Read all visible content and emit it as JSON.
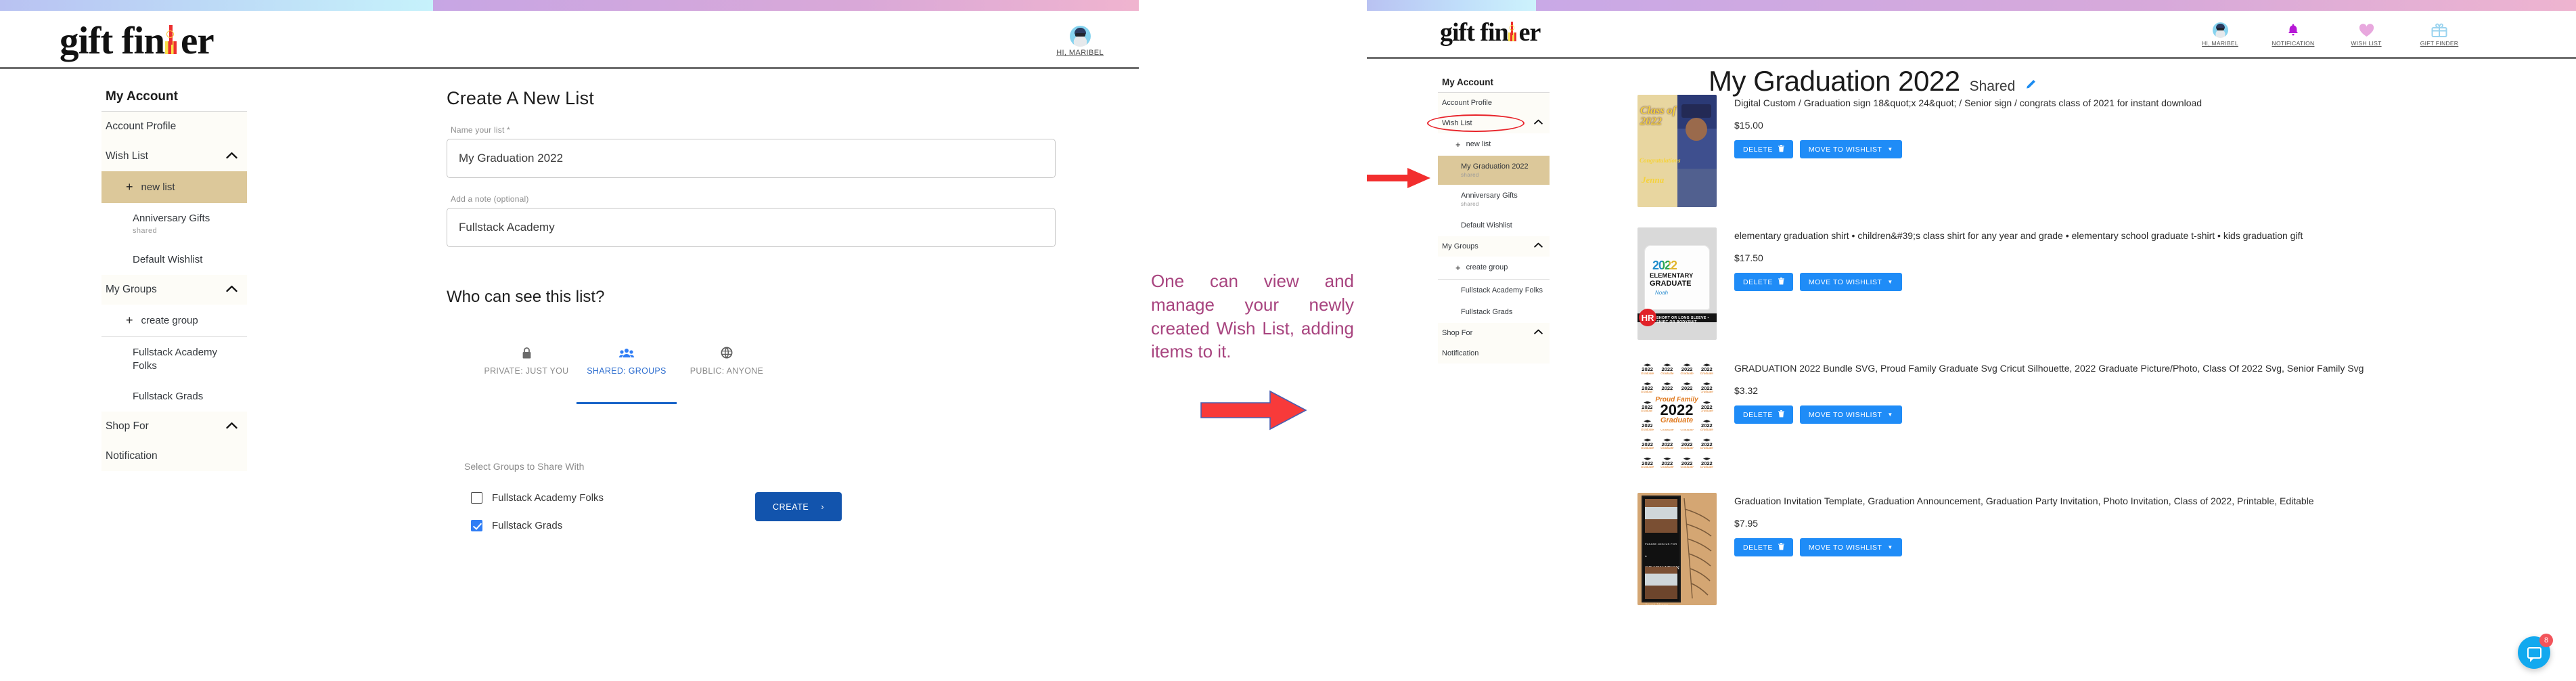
{
  "brand": {
    "name_part1": "gift fin",
    "name_part2": "er",
    "logo_icon": "gift-box-icon"
  },
  "left_panel": {
    "user": {
      "greeting": "HI, MARIBEL",
      "avatar_icon": "user-avatar-icon"
    },
    "sidebar": {
      "title": "My Account",
      "items": [
        {
          "label": "Account Profile",
          "type": "row"
        },
        {
          "label": "Wish List",
          "type": "row",
          "chevron": "chevron-up-icon"
        },
        {
          "label": "new list",
          "type": "action",
          "plus": "plus-icon",
          "highlight": true
        },
        {
          "label": "Anniversary Gifts",
          "note": "shared",
          "type": "sub"
        },
        {
          "label": "Default Wishlist",
          "type": "sub"
        },
        {
          "label": "My Groups",
          "type": "row",
          "chevron": "chevron-up-icon"
        },
        {
          "label": "create group",
          "type": "action",
          "plus": "plus-icon"
        },
        {
          "label": "Fullstack Academy Folks",
          "type": "sub"
        },
        {
          "label": "Fullstack Grads",
          "type": "sub"
        },
        {
          "label": "Shop For",
          "type": "row",
          "chevron": "chevron-up-icon"
        },
        {
          "label": "Notification",
          "type": "row"
        }
      ]
    },
    "form": {
      "title": "Create A New List",
      "name_label": "Name your list *",
      "name_value": "My Graduation 2022",
      "note_label": "Add a note (optional)",
      "note_value": "Fullstack Academy",
      "who_title": "Who can see this list?",
      "privacy_tabs": [
        {
          "label": "PRIVATE: JUST YOU",
          "icon": "lock-icon",
          "active": false
        },
        {
          "label": "SHARED: GROUPS",
          "icon": "group-people-icon",
          "active": true
        },
        {
          "label": "PUBLIC: ANYONE",
          "icon": "globe-icon",
          "active": false
        }
      ],
      "share_label": "Select Groups to Share With",
      "group_options": [
        {
          "label": "Fullstack Academy Folks",
          "checked": false
        },
        {
          "label": "Fullstack Grads",
          "checked": true
        }
      ],
      "create_button": "CREATE",
      "create_caret": "chevron-right-icon"
    }
  },
  "annotation": {
    "text": "One can view and manage your newly created Wish List, adding items to it.",
    "arrow": "right-arrow-icon",
    "color": "#a8447f",
    "arrow_color": "#f83a3a"
  },
  "right_panel": {
    "topnav": [
      {
        "label": "HI, MARIBEL",
        "icon": "user-avatar-icon"
      },
      {
        "label": "NOTIFICATION",
        "icon": "bell-icon"
      },
      {
        "label": "WISH LIST",
        "icon": "heart-icon"
      },
      {
        "label": "GIFT FINDER",
        "icon": "gift-box-icon"
      }
    ],
    "sidebar": {
      "title": "My Account",
      "items": [
        {
          "label": "Account Profile",
          "type": "row"
        },
        {
          "label": "Wish List",
          "type": "row",
          "chevron": "chevron-up-icon",
          "circled": true
        },
        {
          "label": "new list",
          "type": "action",
          "plus": "plus-icon"
        },
        {
          "label": "My Graduation 2022",
          "note": "shared",
          "type": "sub",
          "highlight": true
        },
        {
          "label": "Anniversary Gifts",
          "note": "shared",
          "type": "sub"
        },
        {
          "label": "Default Wishlist",
          "type": "sub"
        },
        {
          "label": "My Groups",
          "type": "row",
          "chevron": "chevron-up-icon"
        },
        {
          "label": "create group",
          "type": "action",
          "plus": "plus-icon"
        },
        {
          "label": "Fullstack Academy Folks",
          "type": "sub"
        },
        {
          "label": "Fullstack Grads",
          "type": "sub"
        },
        {
          "label": "Shop For",
          "type": "row",
          "chevron": "chevron-up-icon"
        },
        {
          "label": "Notification",
          "type": "row"
        }
      ]
    },
    "wishlist": {
      "title": "My Graduation 2022",
      "status": "Shared",
      "edit_icon": "pencil-edit-icon",
      "products": [
        {
          "name": "Digital Custom / Graduation sign 18&quot;x 24&quot; / Senior sign / congrats class of 2021 for instant download",
          "price": "$15.00",
          "delete_label": "DELETE",
          "delete_icon": "trash-icon",
          "move_label": "MOVE TO WISHLIST",
          "move_caret": "caret-down-icon",
          "thumb": "graduation-photo-sign-thumbnail"
        },
        {
          "name": "elementary graduation shirt • children&#39;s class shirt for any year and grade • elementary school graduate t-shirt • kids graduation gift",
          "price": "$17.50",
          "delete_label": "DELETE",
          "delete_icon": "trash-icon",
          "move_label": "MOVE TO WISHLIST",
          "move_caret": "caret-down-icon",
          "thumb": "elementary-graduate-tshirt-thumbnail"
        },
        {
          "name": "GRADUATION 2022 Bundle SVG, Proud Family Graduate Svg Cricut Silhouette, 2022 Graduate Picture/Photo, Class Of 2022 Svg, Senior Family Svg",
          "price": "$3.32",
          "delete_label": "DELETE",
          "delete_icon": "trash-icon",
          "move_label": "MOVE TO WISHLIST",
          "move_caret": "caret-down-icon",
          "thumb": "graduation-svg-bundle-thumbnail"
        },
        {
          "name": "Graduation Invitation Template, Graduation Announcement, Graduation Party Invitation, Photo Invitation, Class of 2022, Printable, Editable",
          "price": "$7.95",
          "delete_label": "DELETE",
          "delete_icon": "trash-icon",
          "move_label": "MOVE TO WISHLIST",
          "move_caret": "caret-down-icon",
          "thumb": "graduation-invitation-template-thumbnail"
        }
      ]
    },
    "chat": {
      "badge": "8",
      "icon": "chat-bubble-icon"
    }
  },
  "colors": {
    "highlight_tan": "#dcc89a",
    "primary_blue": "#1f8cf7",
    "create_blue": "#1254ad",
    "annotation_purple": "#a8447f",
    "annotation_red": "#f83a3a"
  }
}
